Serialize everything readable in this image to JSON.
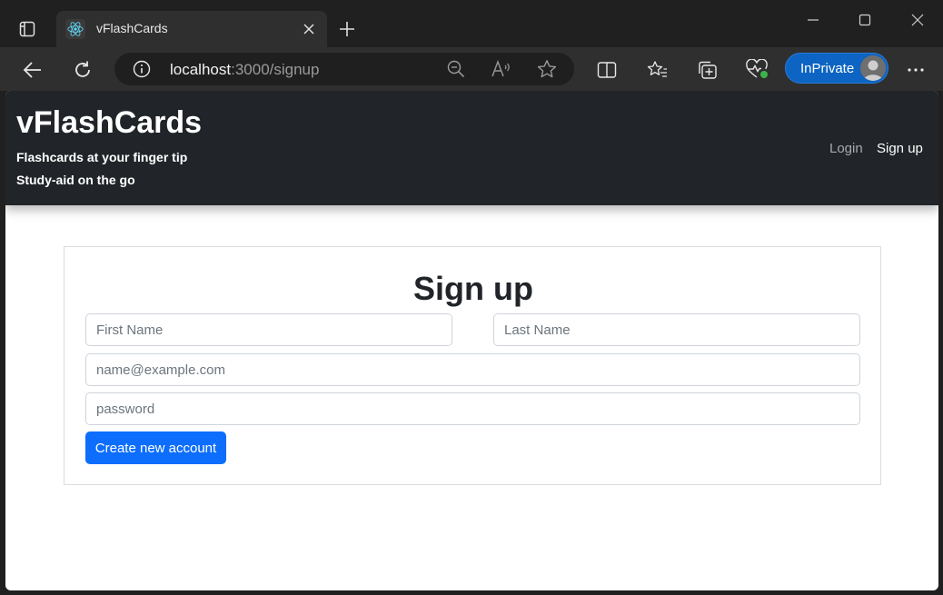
{
  "browser": {
    "tab_title": "vFlashCards",
    "url_host": "localhost",
    "url_path": ":3000/signup",
    "inprivate_label": "InPrivate",
    "accent": "#0d64c2"
  },
  "navbar": {
    "brand": "vFlashCards",
    "tagline_1": "Flashcards at your finger tip",
    "tagline_2": "Study-aid on the go",
    "links": [
      {
        "label": "Login",
        "active": false
      },
      {
        "label": "Sign up",
        "active": true
      }
    ]
  },
  "form": {
    "title": "Sign up",
    "first_name_placeholder": "First Name",
    "last_name_placeholder": "Last Name",
    "email_placeholder": "name@example.com",
    "password_placeholder": "password",
    "submit_label": "Create new account",
    "submit_color": "#0d6efd"
  }
}
